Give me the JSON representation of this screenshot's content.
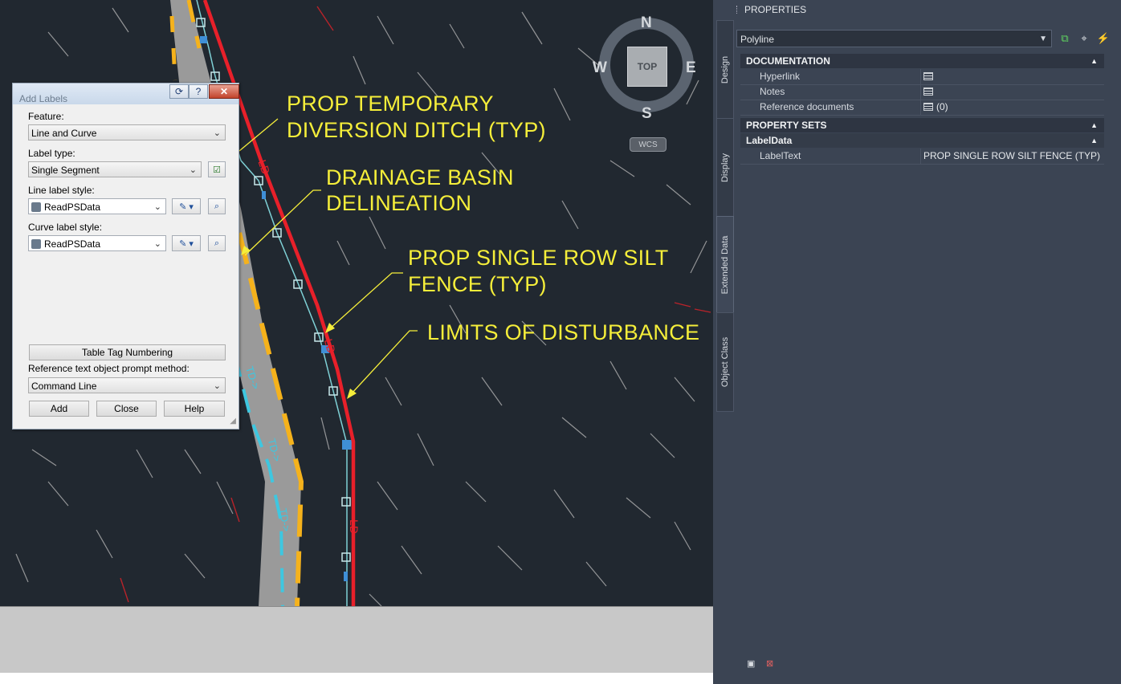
{
  "drawing": {
    "annotations": [
      {
        "line1": "PROP TEMPORARY",
        "line2": "DIVERSION DITCH (TYP)"
      },
      {
        "line1": "DRAINAGE BASIN",
        "line2": "DELINEATION"
      },
      {
        "line1": "PROP SINGLE ROW SILT",
        "line2": "FENCE (TYP)"
      },
      {
        "line1": "LIMITS OF DISTURBANCE",
        "line2": ""
      }
    ],
    "linetype_labels": {
      "silt_fence": "LD",
      "diversion": "TD->"
    },
    "colors": {
      "background": "#212830",
      "annotation": "#f5ee3a",
      "limits_line": "#e8202a",
      "basin_fill": "#9a9a9a",
      "basin_edge": "#f5b21c",
      "ditch": "#3ec7e0",
      "polyline": "#3f8fd6"
    }
  },
  "viewcube": {
    "north": "N",
    "south": "S",
    "east": "E",
    "west": "W",
    "face": "TOP",
    "ucs": "WCS"
  },
  "dialog": {
    "title": "Add Labels",
    "feature_label": "Feature:",
    "feature_value": "Line and Curve",
    "label_type_label": "Label type:",
    "label_type_value": "Single Segment",
    "line_style_label": "Line label style:",
    "line_style_value": "ReadPSData",
    "curve_style_label": "Curve label style:",
    "curve_style_value": "ReadPSData",
    "table_tag_button": "Table Tag Numbering",
    "ref_prompt_label": "Reference text object prompt method:",
    "ref_prompt_value": "Command Line",
    "add_button": "Add",
    "close_button": "Close",
    "help_button": "Help"
  },
  "palette": {
    "title": "PROPERTIES",
    "tabs": [
      "Design",
      "Display",
      "Extended Data",
      "Object Class"
    ],
    "active_tab": "Extended Data",
    "object_type": "Polyline",
    "sections": {
      "documentation": {
        "title": "DOCUMENTATION",
        "rows": [
          {
            "name": "Hyperlink",
            "value": ""
          },
          {
            "name": "Notes",
            "value": ""
          },
          {
            "name": "Reference documents",
            "value": "(0)"
          }
        ]
      },
      "property_sets": {
        "title": "PROPERTY SETS"
      },
      "labeldata": {
        "title": "LabelData",
        "rows": [
          {
            "name": "LabelText",
            "value": "PROP SINGLE ROW SILT FENCE (TYP)"
          }
        ]
      }
    }
  }
}
